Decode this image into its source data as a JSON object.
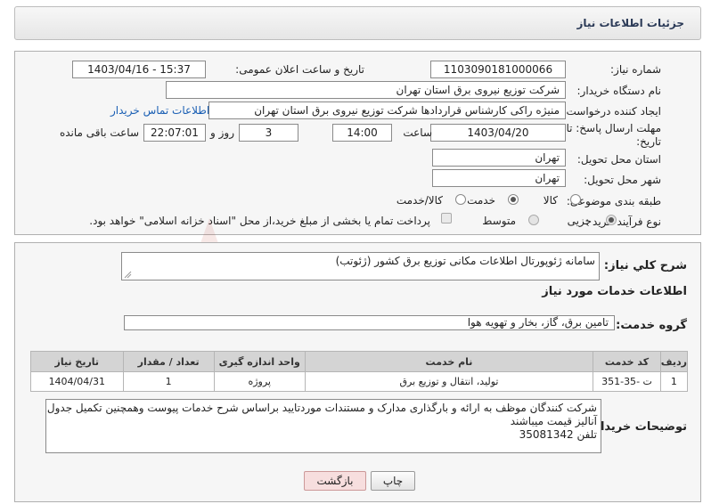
{
  "header": {
    "title": "جزئیات اطلاعات نیاز"
  },
  "form": {
    "need_number_label": "شماره نیاز:",
    "need_number": "1103090181000066",
    "announce_label": "تاریخ و ساعت اعلان عمومی:",
    "announce_value": "1403/04/16 - 15:37",
    "buyer_label": "نام دستگاه خریدار:",
    "buyer_value": "شرکت توزیع نیروی برق استان تهران",
    "creator_label": "ایجاد کننده درخواست:",
    "creator_value": "منیژه راکی کارشناس قراردادها شرکت توزیع نیروی برق استان تهران",
    "contact_link": "اطلاعات تماس خریدار",
    "deadline_label_line1": "مهلت ارسال پاسخ: تا",
    "deadline_label_line2": "تاریخ:",
    "deadline_date": "1403/04/20",
    "time_label": "ساعت",
    "deadline_time": "14:00",
    "days_value": "3",
    "days_label": "روز و",
    "remaining_time": "22:07:01",
    "remaining_label": "ساعت باقی مانده",
    "province_label": "استان محل تحویل:",
    "province_value": "تهران",
    "city_label": "شهر محل تحویل:",
    "city_value": "تهران",
    "category_label": "طبقه بندی موضوعی:",
    "category_options": [
      "کالا",
      "خدمت",
      "کالا/خدمت"
    ],
    "category_selected": "خدمت",
    "process_label": "نوع فرآیند خرید :",
    "process_options": [
      "جزیی",
      "متوسط"
    ],
    "process_selected": "جزیی",
    "payment_note": "پرداخت تمام یا بخشی از مبلغ خرید،از محل \"اسناد خزانه اسلامی\" خواهد بود."
  },
  "summary": {
    "label": "شرح کلي نياز:",
    "value": "سامانه ژئوپورتال اطلاعات مکانی توزیع برق کشور (ژئوتب)"
  },
  "services": {
    "section_title": "اطلاعات خدمات مورد نياز",
    "group_label": "گروه خدمت:",
    "group_value": "تامین برق، گاز، بخار و تهویه هوا",
    "columns": [
      "ردیف",
      "کد خدمت",
      "نام خدمت",
      "واحد اندازه گیری",
      "تعداد / مقدار",
      "تاریخ نیاز"
    ],
    "rows": [
      {
        "index": "1",
        "code": "ت -35-351",
        "name": "تولید، انتقال و توزیع برق",
        "unit": "پروژه",
        "qty": "1",
        "date": "1404/04/31"
      }
    ]
  },
  "buyer_notes": {
    "label": "توضیحات خریدار:",
    "line1": "شرکت کنندگان موظف به ارائه و بارگذاری مدارک و مستندات موردتایید براساس شرح خدمات پیوست  وهمچنین تکمیل جدول",
    "line2": "آنالیز قیمت میباشند",
    "line3": "تلفن 35081342"
  },
  "buttons": {
    "print": "چاپ",
    "back": "بازگشت"
  },
  "watermark": {
    "text": "AriaTender.net"
  },
  "colors": {
    "accent": "#2b3a57",
    "link": "#1a5fb4",
    "back_button": "#f7dede",
    "watermark": "#c0392b"
  }
}
